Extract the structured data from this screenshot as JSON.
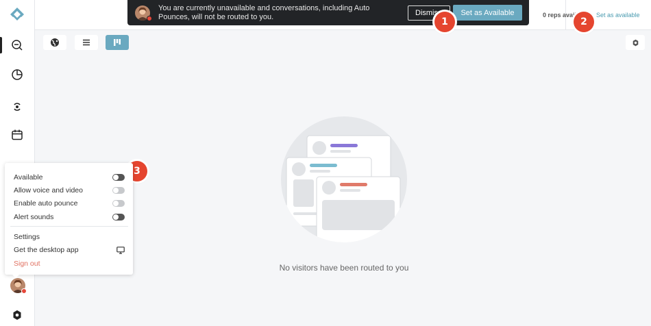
{
  "banner": {
    "message": "You are currently unavailable and conversations, including Auto Pounces, will not be routed to you.",
    "dismiss_label": "Dismiss",
    "available_label": "Set as Available"
  },
  "topbar": {
    "reps_text": "0 reps avail",
    "set_available_link": "Set as available"
  },
  "badges": [
    "1",
    "2",
    "3"
  ],
  "toolbar": {
    "views": [
      {
        "icon": "globe-icon",
        "active": false
      },
      {
        "icon": "list-icon",
        "active": false
      },
      {
        "icon": "board-icon",
        "active": true
      }
    ]
  },
  "sidebar": {
    "items": [
      {
        "icon": "conversations-icon"
      },
      {
        "icon": "reports-icon"
      },
      {
        "icon": "routing-icon"
      },
      {
        "icon": "calendar-icon"
      }
    ]
  },
  "empty_state": {
    "message": "No visitors have been routed to you"
  },
  "menu": {
    "toggles": [
      {
        "label": "Available",
        "on": false,
        "enabled": true
      },
      {
        "label": "Allow voice and video",
        "on": false,
        "enabled": false
      },
      {
        "label": "Enable auto pounce",
        "on": false,
        "enabled": false
      },
      {
        "label": "Alert sounds",
        "on": false,
        "enabled": true
      }
    ],
    "settings_label": "Settings",
    "desktop_label": "Get the desktop app",
    "signout_label": "Sign out"
  },
  "colors": {
    "accent": "#6aa9c0",
    "badge": "#e5452f",
    "status_unavailable": "#e5473a",
    "signout": "#e07060"
  }
}
